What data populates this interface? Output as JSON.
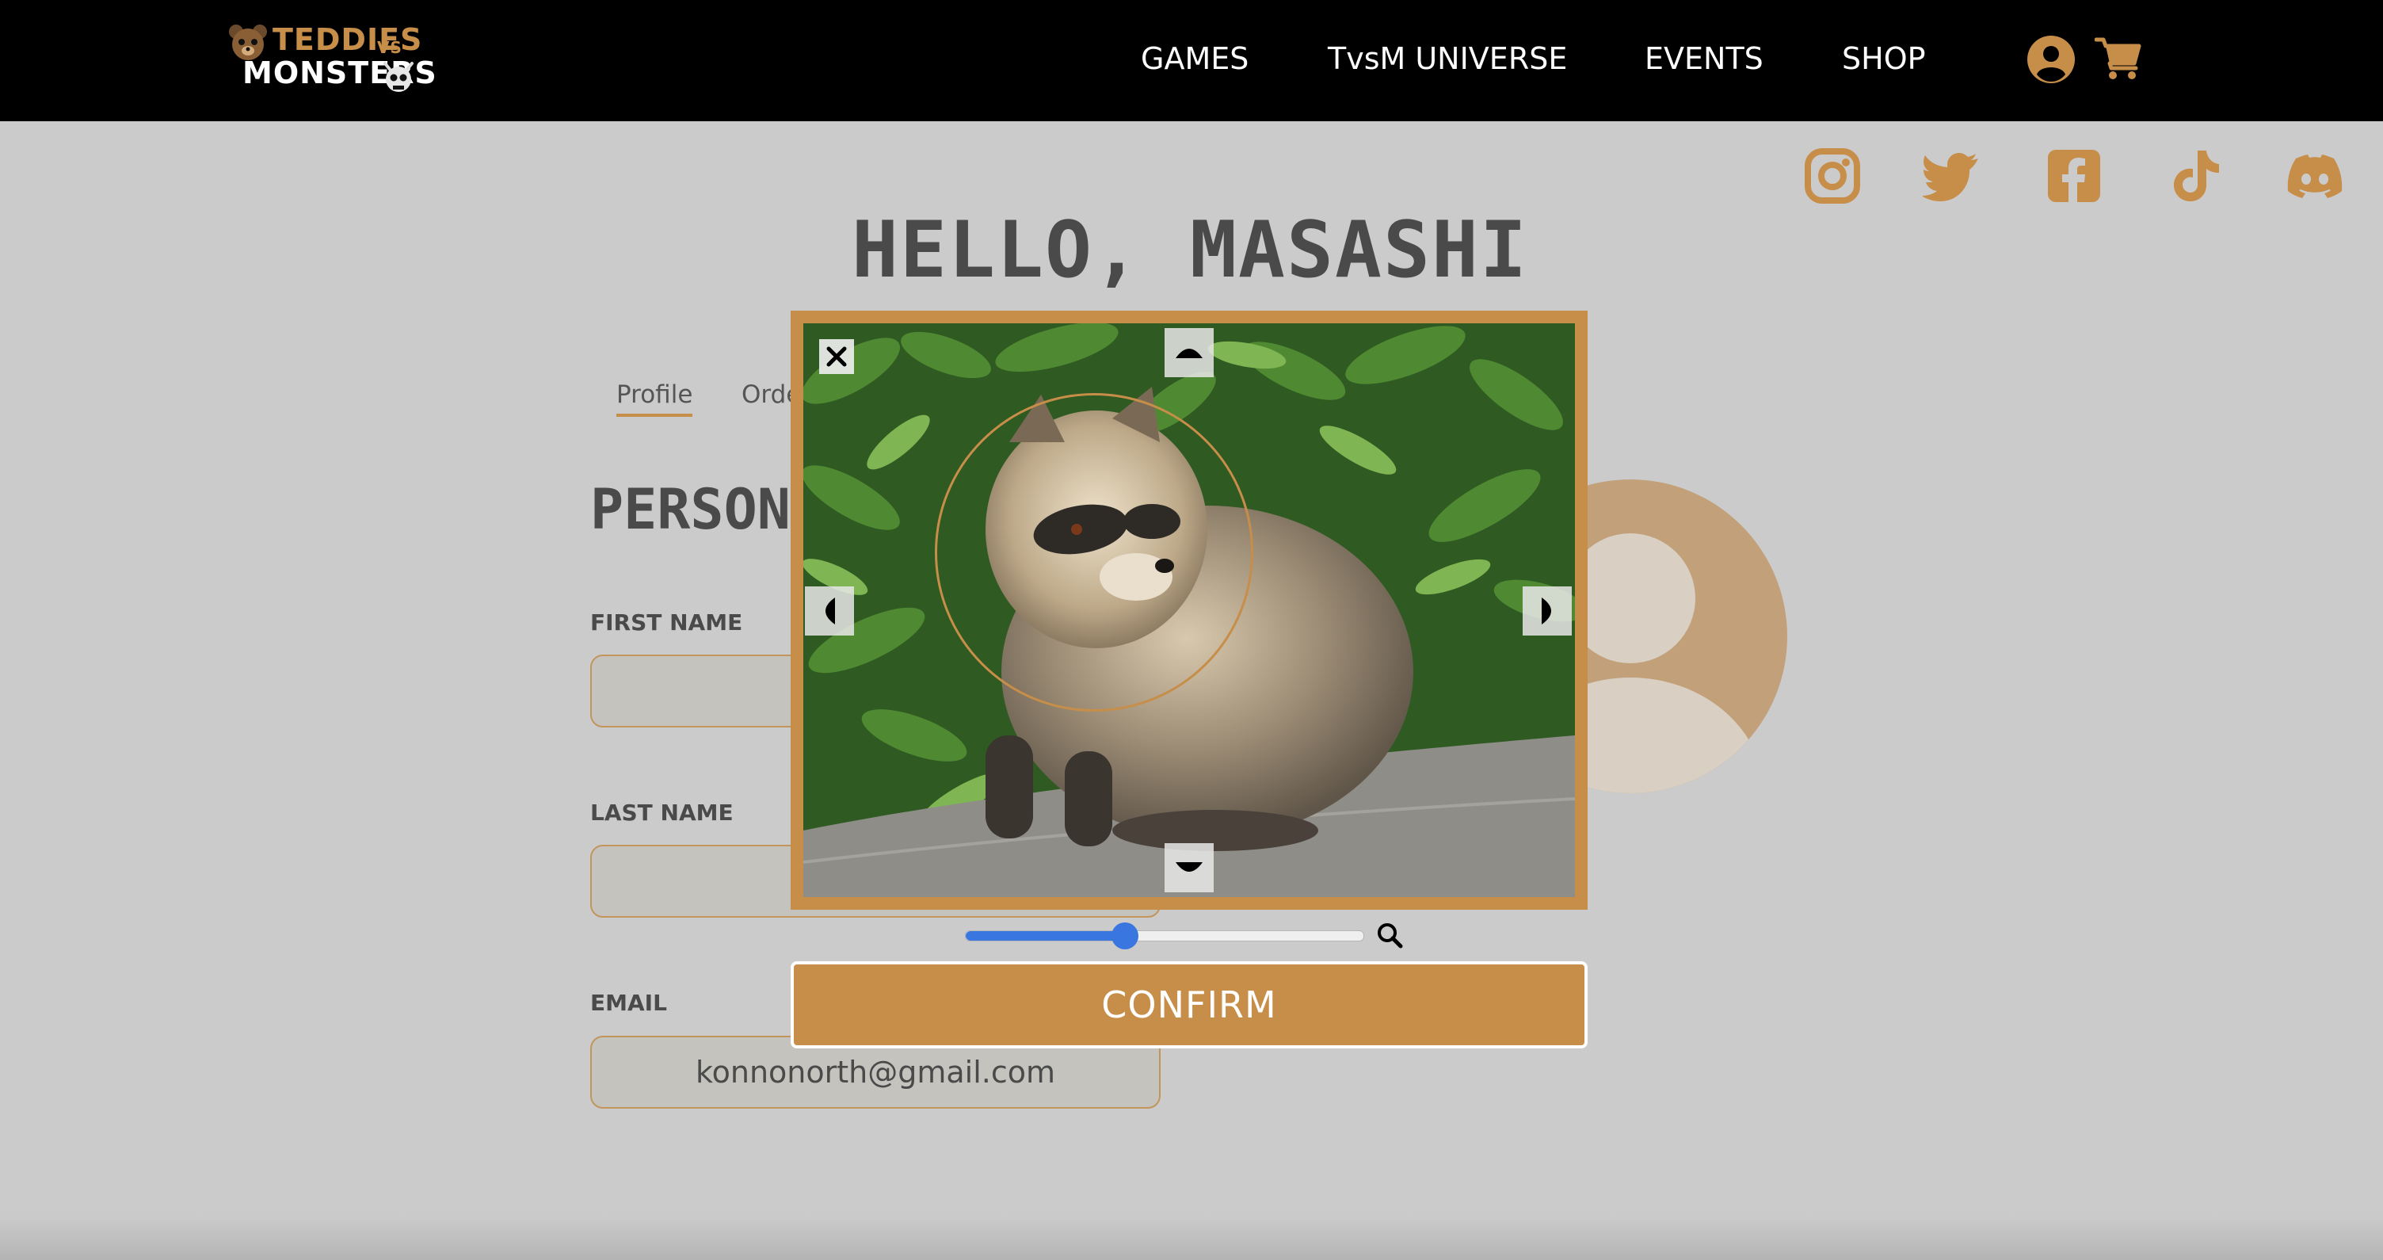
{
  "brand": {
    "logo_line1": "TEDDIES",
    "logo_vs": "VS",
    "logo_line2": "MONSTERS"
  },
  "nav": {
    "items": [
      "GAMES",
      "TvsM UNIVERSE",
      "EVENTS",
      "SHOP"
    ],
    "icons": [
      "account-icon",
      "cart-icon"
    ]
  },
  "social": {
    "icons": [
      "instagram-icon",
      "twitter-icon",
      "facebook-icon",
      "tiktok-icon",
      "discord-icon"
    ]
  },
  "profile": {
    "greeting": "HELLO, MASASHI",
    "tabs": [
      "Profile",
      "Orde"
    ],
    "section_title": "PERSONA",
    "fields": [
      {
        "label": "FIRST NAME",
        "value": ""
      },
      {
        "label": "LAST NAME",
        "value": ""
      },
      {
        "label": "EMAIL",
        "value": "konnonorth@gmail.com"
      }
    ]
  },
  "cropper": {
    "zoom_fraction": 0.4,
    "confirm_label": "CONFIRM",
    "icons": [
      "close-icon",
      "arrow-up-icon",
      "arrow-down-icon",
      "arrow-left-icon",
      "arrow-right-icon",
      "zoom-icon"
    ]
  },
  "colors": {
    "brand": "#c68e49",
    "topbar": "#000000",
    "background": "#cbcbcb",
    "slider": "#3a76e0"
  }
}
